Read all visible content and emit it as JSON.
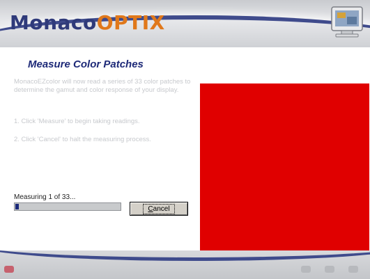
{
  "header": {
    "logo_part1": "Monaco",
    "logo_part2": "OPTIX",
    "monitor_icon": "monitor-icon"
  },
  "page": {
    "title": "Measure Color Patches",
    "description": "MonacoEZcolor will now read a series of 33 color patches to determine the gamut and color response of your display.",
    "step1": "1. Click 'Measure' to begin taking readings.",
    "step2": "2. Click 'Cancel' to halt the measuring process."
  },
  "status": {
    "text": "Measuring 1 of 33...",
    "progress_fraction": 0.03
  },
  "buttons": {
    "cancel_underlined": "C",
    "cancel_rest": "ancel"
  },
  "patch": {
    "color": "#e00000"
  },
  "colors": {
    "brand_blue": "#2f3a7a",
    "brand_orange": "#e0781b",
    "progress": "#1c2a7a"
  }
}
